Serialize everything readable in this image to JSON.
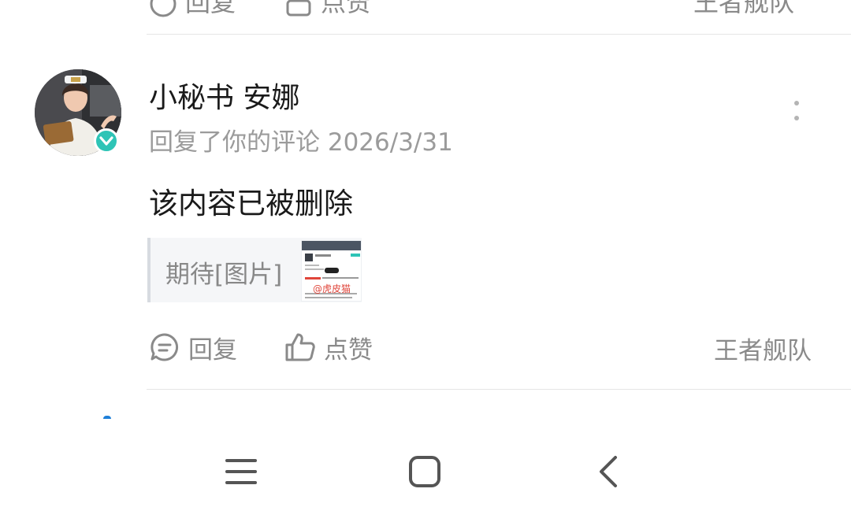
{
  "previous_item": {
    "reply_label": "回复",
    "like_label": "点赞",
    "tag_label": "王者舰队"
  },
  "notification": {
    "user_name": "小秘书 安娜",
    "meta_text": "回复了你的评论 2026/3/31",
    "content": "该内容已被删除",
    "quote_text": "期待[图片]",
    "quote_thumbnail_watermark": "@虎皮猫",
    "reply_label": "回复",
    "like_label": "点赞",
    "tag_label": "王者舰队",
    "verified_badge_color": "#2ec4b6"
  },
  "icons": {
    "reply": "chat-bubble-icon",
    "like": "thumbs-up-icon",
    "more": "vertical-ellipsis-icon",
    "verified": "verified-check-icon",
    "nav_menu": "menu-lines-icon",
    "nav_home": "rounded-square-icon",
    "nav_back": "chevron-left-icon"
  }
}
